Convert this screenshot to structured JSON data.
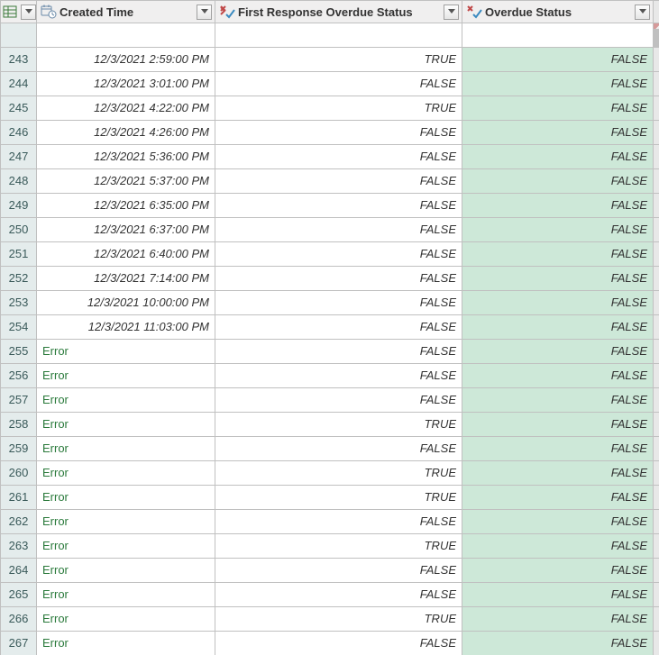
{
  "columns": {
    "col1": "Created Time",
    "col2": "First Response Overdue Status",
    "col3": "Overdue Status"
  },
  "error_text": "Error",
  "rows": [
    {
      "num": 243,
      "time": "12/3/2021 2:59:00 PM",
      "err": false,
      "c2": "TRUE",
      "c3": "FALSE"
    },
    {
      "num": 244,
      "time": "12/3/2021 3:01:00 PM",
      "err": false,
      "c2": "FALSE",
      "c3": "FALSE"
    },
    {
      "num": 245,
      "time": "12/3/2021 4:22:00 PM",
      "err": false,
      "c2": "TRUE",
      "c3": "FALSE"
    },
    {
      "num": 246,
      "time": "12/3/2021 4:26:00 PM",
      "err": false,
      "c2": "FALSE",
      "c3": "FALSE"
    },
    {
      "num": 247,
      "time": "12/3/2021 5:36:00 PM",
      "err": false,
      "c2": "FALSE",
      "c3": "FALSE"
    },
    {
      "num": 248,
      "time": "12/3/2021 5:37:00 PM",
      "err": false,
      "c2": "FALSE",
      "c3": "FALSE"
    },
    {
      "num": 249,
      "time": "12/3/2021 6:35:00 PM",
      "err": false,
      "c2": "FALSE",
      "c3": "FALSE"
    },
    {
      "num": 250,
      "time": "12/3/2021 6:37:00 PM",
      "err": false,
      "c2": "FALSE",
      "c3": "FALSE"
    },
    {
      "num": 251,
      "time": "12/3/2021 6:40:00 PM",
      "err": false,
      "c2": "FALSE",
      "c3": "FALSE"
    },
    {
      "num": 252,
      "time": "12/3/2021 7:14:00 PM",
      "err": false,
      "c2": "FALSE",
      "c3": "FALSE"
    },
    {
      "num": 253,
      "time": "12/3/2021 10:00:00 PM",
      "err": false,
      "c2": "FALSE",
      "c3": "FALSE"
    },
    {
      "num": 254,
      "time": "12/3/2021 11:03:00 PM",
      "err": false,
      "c2": "FALSE",
      "c3": "FALSE"
    },
    {
      "num": 255,
      "err": true,
      "c2": "FALSE",
      "c3": "FALSE"
    },
    {
      "num": 256,
      "err": true,
      "c2": "FALSE",
      "c3": "FALSE"
    },
    {
      "num": 257,
      "err": true,
      "c2": "FALSE",
      "c3": "FALSE"
    },
    {
      "num": 258,
      "err": true,
      "c2": "TRUE",
      "c3": "FALSE"
    },
    {
      "num": 259,
      "err": true,
      "c2": "FALSE",
      "c3": "FALSE"
    },
    {
      "num": 260,
      "err": true,
      "c2": "TRUE",
      "c3": "FALSE"
    },
    {
      "num": 261,
      "err": true,
      "c2": "TRUE",
      "c3": "FALSE"
    },
    {
      "num": 262,
      "err": true,
      "c2": "FALSE",
      "c3": "FALSE"
    },
    {
      "num": 263,
      "err": true,
      "c2": "TRUE",
      "c3": "FALSE"
    },
    {
      "num": 264,
      "err": true,
      "c2": "FALSE",
      "c3": "FALSE"
    },
    {
      "num": 265,
      "err": true,
      "c2": "FALSE",
      "c3": "FALSE"
    },
    {
      "num": 266,
      "err": true,
      "c2": "TRUE",
      "c3": "FALSE"
    },
    {
      "num": 267,
      "err": true,
      "c2": "FALSE",
      "c3": "FALSE"
    }
  ]
}
